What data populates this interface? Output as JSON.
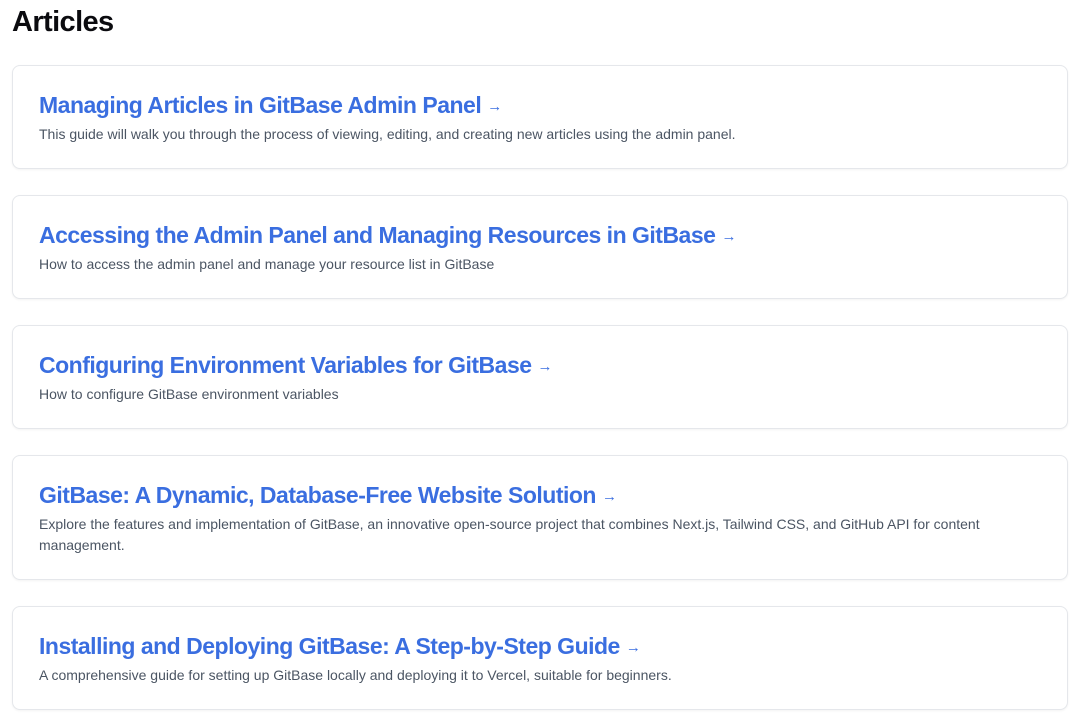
{
  "page": {
    "title": "Articles"
  },
  "articles": [
    {
      "title": "Managing Articles in GitBase Admin Panel",
      "description": "This guide will walk you through the process of viewing, editing, and creating new articles using the admin panel."
    },
    {
      "title": "Accessing the Admin Panel and Managing Resources in GitBase",
      "description": "How to access the admin panel and manage your resource list in GitBase"
    },
    {
      "title": "Configuring Environment Variables for GitBase",
      "description": "How to configure GitBase environment variables"
    },
    {
      "title": "GitBase: A Dynamic, Database-Free Website Solution",
      "description": "Explore the features and implementation of GitBase, an innovative open-source project that combines Next.js, Tailwind CSS, and GitHub API for content management."
    },
    {
      "title": "Installing and Deploying GitBase: A Step-by-Step Guide",
      "description": "A comprehensive guide for setting up GitBase locally and deploying it to Vercel, suitable for beginners."
    }
  ],
  "icons": {
    "arrow": "→"
  },
  "colors": {
    "link": "#3a6ee0",
    "description": "#4b5563",
    "border": "#e5e7eb"
  }
}
